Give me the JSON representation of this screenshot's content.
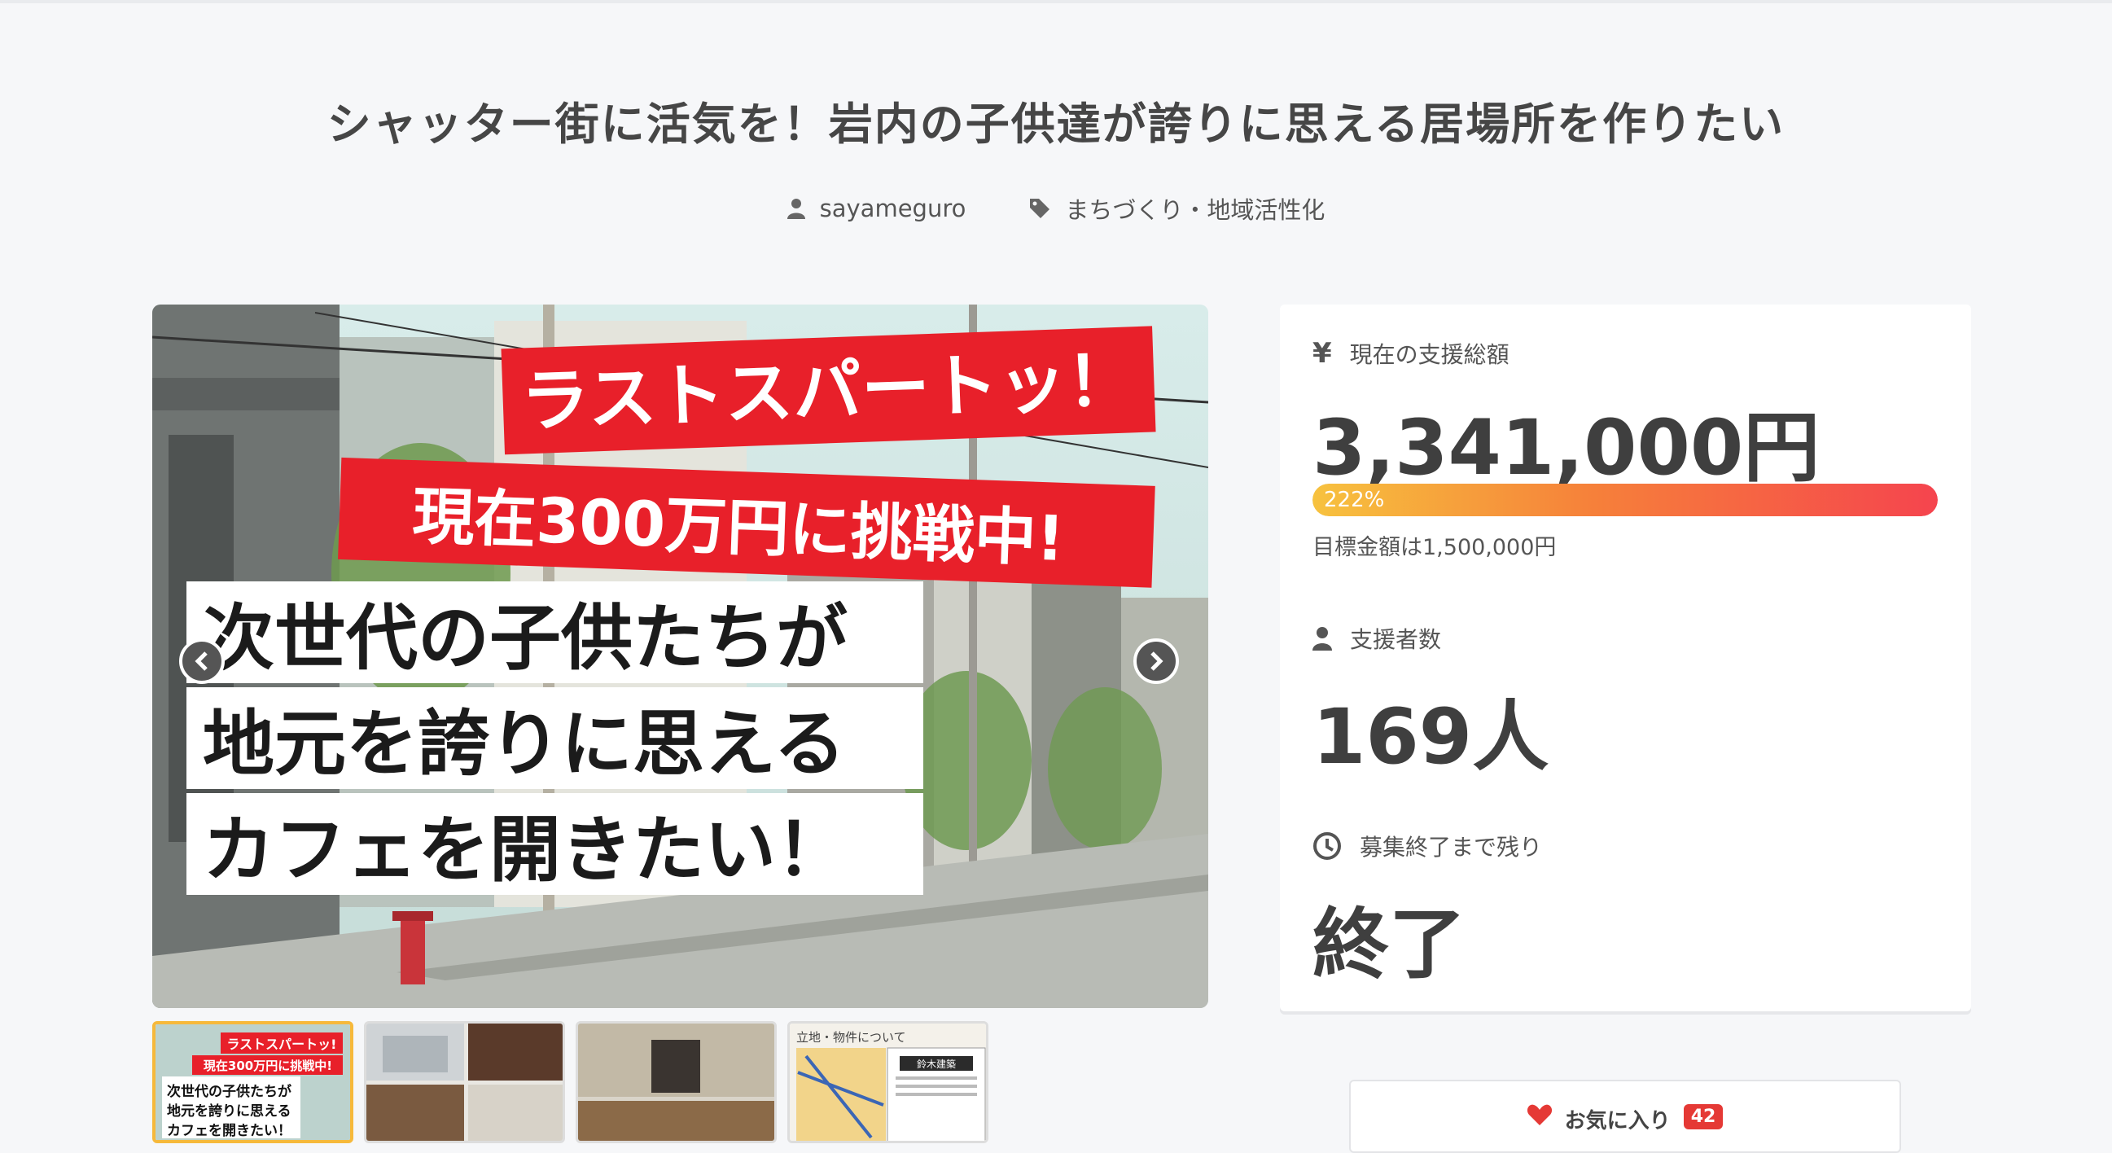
{
  "project": {
    "title": "シャッター街に活気を！岩内の子供達が誇りに思える居場所を作りたい",
    "author": "sayameguro",
    "category": "まちづくり・地域活性化"
  },
  "slider": {
    "banner_line1": "ラストスパートッ！",
    "banner_line2": "現在300万円に挑戦中!",
    "caption_lines": [
      "次世代の子供たちが",
      "地元を誇りに思える",
      "カフェを開きたい！"
    ],
    "thumb_1_lines": [
      "ラストスパートッ!",
      "現在300万円に挑戦中!",
      "次世代の子供たちが",
      "地元を誇りに思える",
      "カフェを開きたい！"
    ],
    "thumb_4_title": "立地・物件について",
    "thumb_4_label": "鈴木建築"
  },
  "stats": {
    "currency_icon": "¥",
    "raised_label": "現在の支援総額",
    "raised_amount": "3,341,000円",
    "percent_text": "222%",
    "percent_value": 222,
    "goal_text": "目標金額は1,500,000円",
    "backers_label": "支援者数",
    "backers_count": "169人",
    "remaining_label": "募集終了まで残り",
    "remaining_value": "終了"
  },
  "favorite": {
    "label": "お気に入り",
    "count": "42"
  },
  "colors": {
    "progress_start": "#f7c23e",
    "progress_end": "#f5444e",
    "banner_red": "#e8202a",
    "badge_red": "#e53935"
  }
}
